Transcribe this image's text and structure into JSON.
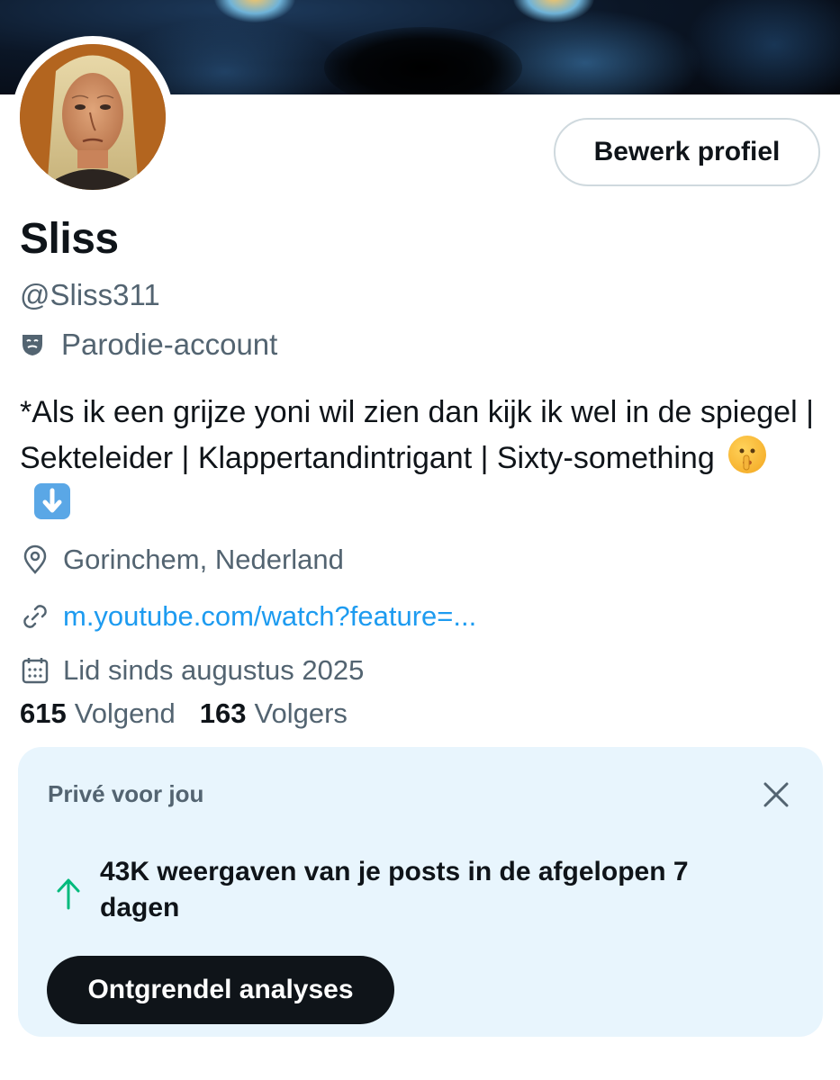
{
  "profile": {
    "edit_label": "Bewerk profiel",
    "name": "Sliss",
    "handle": "@Sliss311",
    "parody_label": "Parodie-account",
    "bio_text": "*Als ik een grijze yoni wil zien dan kijk ik wel in de spiegel | Sekteleider | Klappertandintrigant | Sixty-something",
    "bio_emojis": [
      "shushing-face",
      "down-arrow"
    ],
    "location": "Gorinchem, Nederland",
    "link": "m.youtube.com/watch?feature=...",
    "joined": "Lid sinds augustus 2025",
    "following_count": "615",
    "following_label": "Volgend",
    "followers_count": "163",
    "followers_label": "Volgers"
  },
  "insights_card": {
    "title": "Privé voor jou",
    "stat": "43K weergaven van je posts in de afgelopen 7 dagen",
    "button_label": "Ontgrendel analyses",
    "accent_color": "#00ba7c"
  },
  "colors": {
    "link": "#1d9bf0",
    "muted": "#536471",
    "card_bg": "#e8f5fd",
    "button_dark": "#0f1419"
  },
  "icons": {
    "parody": "theater-masks-icon",
    "location": "map-pin-icon",
    "link": "link-icon",
    "joined": "calendar-icon",
    "close": "close-icon",
    "trend": "arrow-up-icon"
  }
}
